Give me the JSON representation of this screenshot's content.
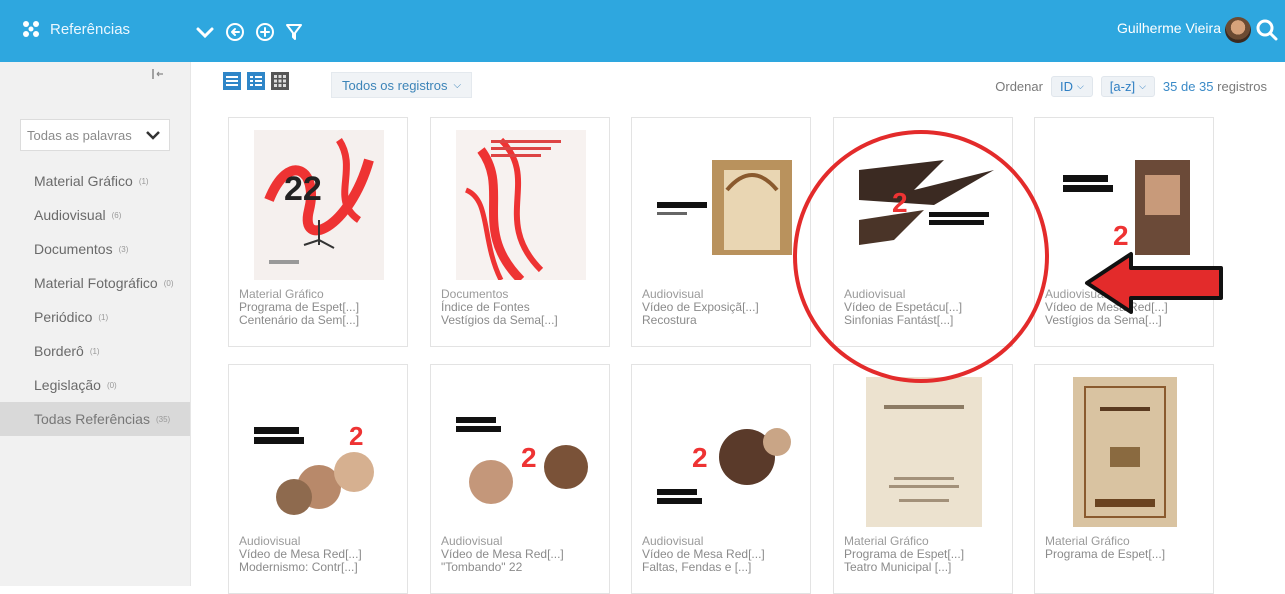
{
  "app": {
    "title": "Referências"
  },
  "user": {
    "name": "Guilherme Vieira"
  },
  "sidebar": {
    "filter_selected": "Todas as palavras",
    "items": [
      {
        "label": "Material Gráfico",
        "count": "(1)"
      },
      {
        "label": "Audiovisual",
        "count": "(6)"
      },
      {
        "label": "Documentos",
        "count": "(3)"
      },
      {
        "label": "Material Fotográfico",
        "count": "(0)"
      },
      {
        "label": "Periódico",
        "count": "(1)"
      },
      {
        "label": "Borderô",
        "count": "(1)"
      },
      {
        "label": "Legislação",
        "count": "(0)"
      },
      {
        "label": "Todas Referências",
        "count": "(35)"
      }
    ]
  },
  "toolbar": {
    "records_filter": "Todos os registros",
    "order_label": "Ordenar",
    "order_field": "ID",
    "order_dir": "[a-z]",
    "count_highlight": "35 de 35",
    "count_suffix": "registros"
  },
  "cards": [
    {
      "type": "Material Gráfico",
      "line1": "Programa de Espet[...]",
      "line2": "Centenário da Sem[...]"
    },
    {
      "type": "Documentos",
      "line1": "Índice de Fontes",
      "line2": "Vestígios da Sema[...]"
    },
    {
      "type": "Audiovisual",
      "line1": "Vídeo de Exposiçã[...]",
      "line2": "Recostura"
    },
    {
      "type": "Audiovisual",
      "line1": "Vídeo de Espetácu[...]",
      "line2": "Sinfonias Fantást[...]"
    },
    {
      "type": "Audiovisual",
      "line1": "Vídeo de Mesa Red[...]",
      "line2": "Vestígios da Sema[...]"
    },
    {
      "type": "Audiovisual",
      "line1": "Vídeo de Mesa Red[...]",
      "line2": "Modernismo: Contr[...]"
    },
    {
      "type": "Audiovisual",
      "line1": "Vídeo de Mesa Red[...]",
      "line2": "\"Tombando\" 22"
    },
    {
      "type": "Audiovisual",
      "line1": "Vídeo de Mesa Red[...]",
      "line2": "Faltas, Fendas e [...]"
    },
    {
      "type": "Material Gráfico",
      "line1": "Programa de Espet[...]",
      "line2": "Teatro Municipal [...]"
    },
    {
      "type": "Material Gráfico",
      "line1": "Programa de Espet[...]",
      "line2": ""
    }
  ],
  "colors": {
    "topbar": "#2ea7df",
    "accent": "#3a8ac7",
    "annotation": "#e32b2b"
  },
  "icons": [
    "logo-icon",
    "chevron-down-icon",
    "back-circle-icon",
    "add-circle-icon",
    "filter-icon",
    "search-icon",
    "collapse-icon"
  ]
}
